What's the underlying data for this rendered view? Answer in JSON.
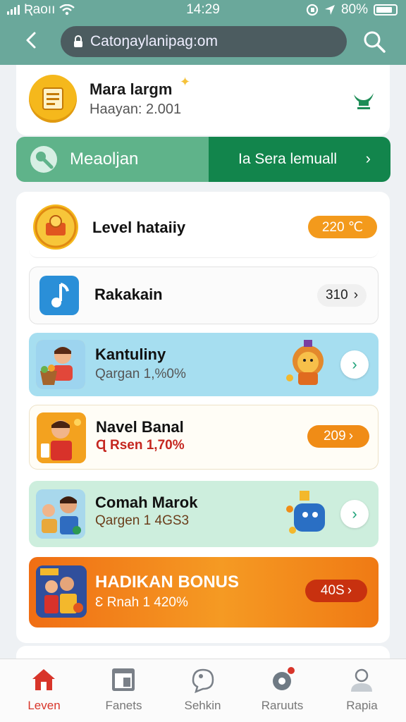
{
  "status_bar": {
    "carrier": "Ʀaoıı",
    "time": "14:29",
    "battery_pct": "80%"
  },
  "browser": {
    "url": "Catoŋaylanipag:om"
  },
  "profile": {
    "name": "Mara largm",
    "sub": "Haayan: 2.001"
  },
  "action_split": {
    "left_label": "Meaoljan",
    "right_label": "Ia Sera lemuall"
  },
  "list": {
    "items": [
      {
        "title": "Level hataiiy",
        "badge": "220 ℃"
      },
      {
        "title": "Rakakain",
        "value": "310"
      },
      {
        "title": "Kantuliny",
        "sub": "Qargan 1,%0%"
      },
      {
        "title": "Navel Banal",
        "sub": "Ɋ Rsen 1,70%",
        "badge": "209"
      },
      {
        "title": "Comah Marok",
        "sub": "Qargen 1 4GS3"
      },
      {
        "title": "HADIKAN BONUS",
        "sub": "Ɛ Rnah 1 420%",
        "badge": "40S"
      }
    ]
  },
  "bottom_nav": {
    "tabs": [
      {
        "label": "Leven",
        "icon": "home-icon",
        "active": true
      },
      {
        "label": "Fanets",
        "icon": "window-icon",
        "active": false
      },
      {
        "label": "Sehkin",
        "icon": "chat-icon",
        "active": false
      },
      {
        "label": "Raruuts",
        "icon": "settings-icon",
        "active": false
      },
      {
        "label": "Rapia",
        "icon": "profile-icon",
        "active": false
      }
    ]
  },
  "colors": {
    "topbar": "#6aa89b",
    "accent_green": "#12854c",
    "light_green": "#5fb38a",
    "orange": "#f08c16",
    "red_active": "#d8352a"
  }
}
